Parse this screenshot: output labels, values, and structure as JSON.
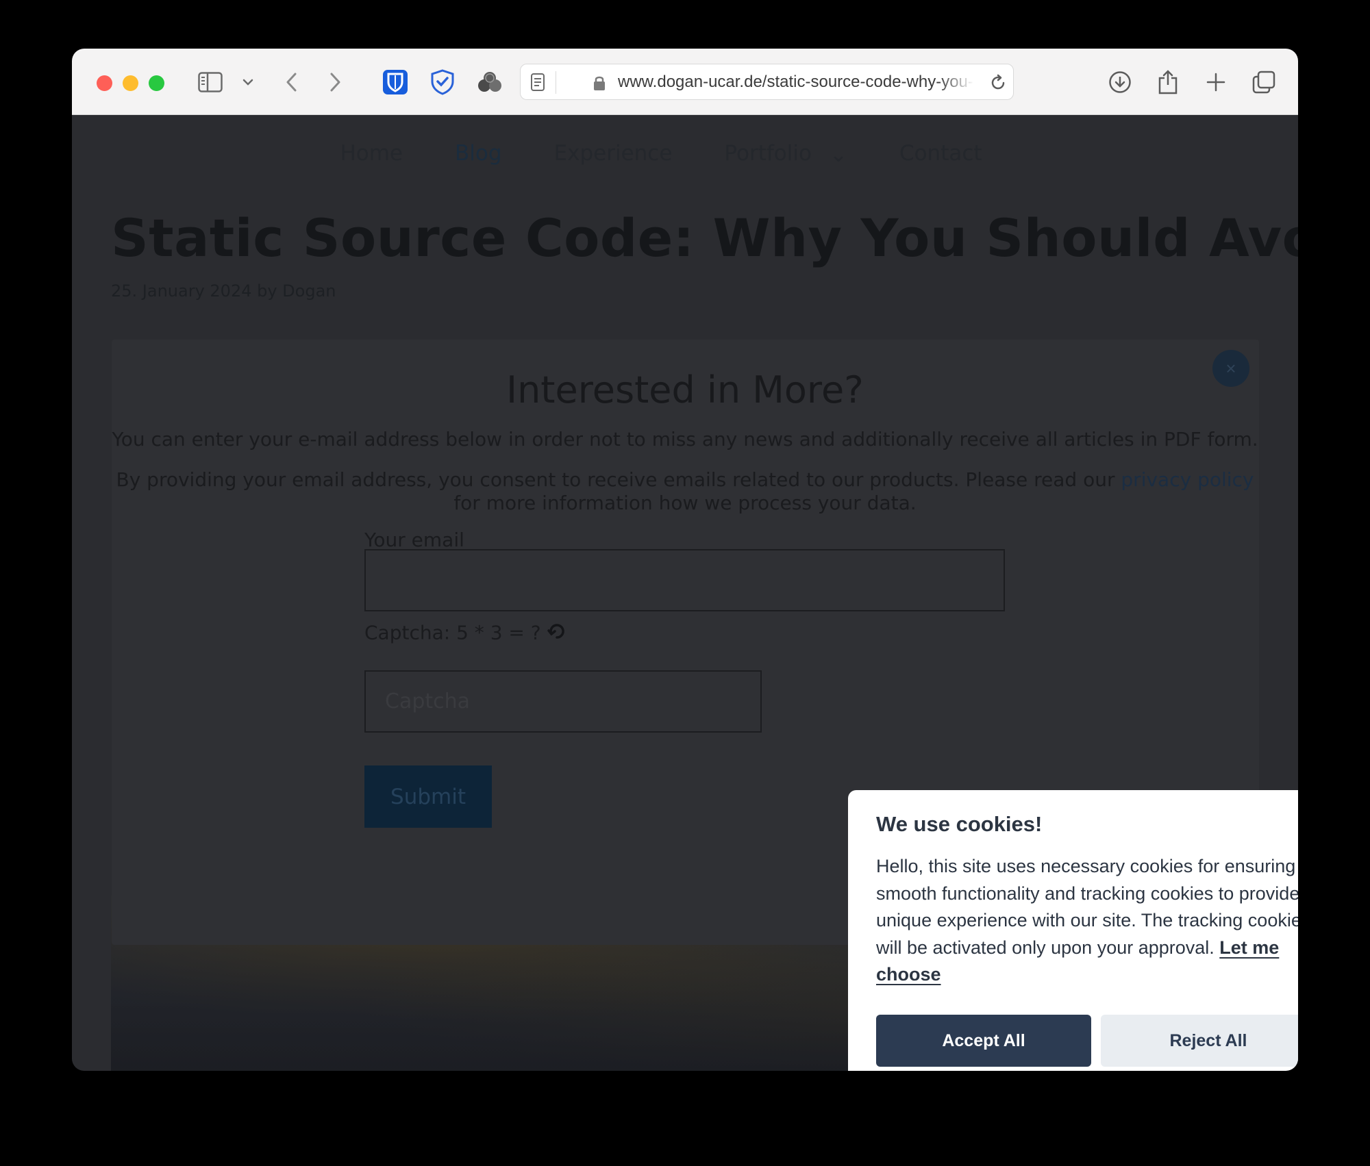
{
  "browser": {
    "url": "www.dogan-ucar.de/static-source-code-why-you-should-avoid-it",
    "icons": [
      "sidebar-icon",
      "chevron-down-icon",
      "back-icon",
      "forward-icon",
      "bitwarden-icon",
      "shield-icon",
      "tracker-icon",
      "reader-icon",
      "lock-icon",
      "reload-icon",
      "download-icon",
      "share-icon",
      "new-tab-icon",
      "tab-overview-icon"
    ]
  },
  "site": {
    "nav": {
      "home": "Home",
      "blog": "Blog",
      "experience": "Experience",
      "portfolio": "Portfolio",
      "contact": "Contact"
    },
    "post_title": "Static Source Code: Why You Should Avoid it",
    "post_meta": "25. January 2024 by Dogan"
  },
  "modal": {
    "close": "×",
    "title": "Interested in More?",
    "intro": "You can enter your e-mail address below in order not to miss any news and additionally receive all articles in PDF form.",
    "consent_before_link": "By providing your email address, you consent to receive emails related to our products. Please read our ",
    "consent_link": "privacy policy",
    "consent_after_link": "for more information how we process your data.",
    "email_label": "Your email",
    "email_value": "",
    "captcha_label": "Captcha: 5 * 3 = ?",
    "captcha_placeholder": "Captcha",
    "submit_label": "Submit"
  },
  "cookie": {
    "title": "We use cookies!",
    "body": "Hello, this site uses necessary cookies for ensuring smooth functionality and tracking cookies to provide a unique experience with our site. The tracking cookies will be activated only upon your approval. ",
    "link": "Let me choose",
    "accept_label": "Accept All",
    "reject_label": "Reject All"
  }
}
